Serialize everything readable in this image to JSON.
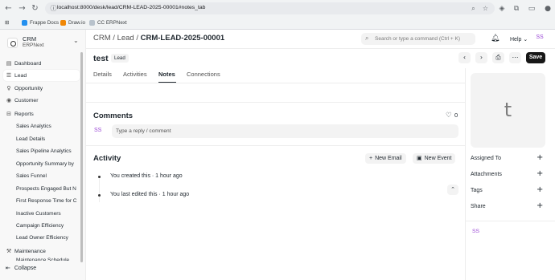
{
  "browser": {
    "url": "localhost:8000/desk/lead/CRM-LEAD-2025-00001#notes_tab",
    "bookmarks": [
      {
        "label": "Frappe Docs",
        "color": "#2490ef"
      },
      {
        "label": "Draw.io",
        "color": "#f08705"
      },
      {
        "label": "CC ERPNext",
        "color": "#b8c2cc"
      }
    ]
  },
  "sidebar": {
    "app_name": "CRM",
    "app_sub": "ERPNext",
    "items": [
      {
        "label": "Dashboard",
        "icon": "dashboard-icon"
      },
      {
        "label": "Lead",
        "icon": "lead-icon"
      },
      {
        "label": "Opportunity",
        "icon": "opportunity-icon"
      },
      {
        "label": "Customer",
        "icon": "customer-icon"
      },
      {
        "label": "Reports",
        "icon": "reports-icon"
      }
    ],
    "reports": [
      "Sales Analytics",
      "Lead Details",
      "Sales Pipeline Analytics",
      "Opportunity Summary by",
      "Sales Funnel",
      "Prospects Engaged But N",
      "First Response Time for C",
      "Inactive Customers",
      "Campaign Efficiency",
      "Lead Owner Efficiency"
    ],
    "maintenance": "Maintenance",
    "maintenance_sub": "Maintenance Schedule",
    "collapse": "Collapse"
  },
  "navbar": {
    "breadcrumb": [
      "CRM",
      "Lead",
      "CRM-LEAD-2025-00001"
    ],
    "search_placeholder": "Search or type a command (Ctrl + K)",
    "help": "Help",
    "avatar": "SS"
  },
  "doc": {
    "title": "test",
    "status": "Lead",
    "save": "Save",
    "tabs": [
      "Details",
      "Activities",
      "Notes",
      "Connections"
    ],
    "active_tab": "Notes"
  },
  "comments": {
    "title": "Comments",
    "likes": "0",
    "avatar": "SS",
    "placeholder": "Type a reply / comment"
  },
  "activity": {
    "title": "Activity",
    "new_email": "New Email",
    "new_event": "New Event",
    "items": [
      "You created this · 1 hour ago",
      "You last edited this · 1 hour ago"
    ]
  },
  "sidepanel": {
    "image_letter": "t",
    "labels": [
      "Assigned To",
      "Attachments",
      "Tags",
      "Share"
    ],
    "avatar": "SS"
  },
  "colors": {
    "avatar": "#9c4ad6",
    "primary": "#171717"
  }
}
